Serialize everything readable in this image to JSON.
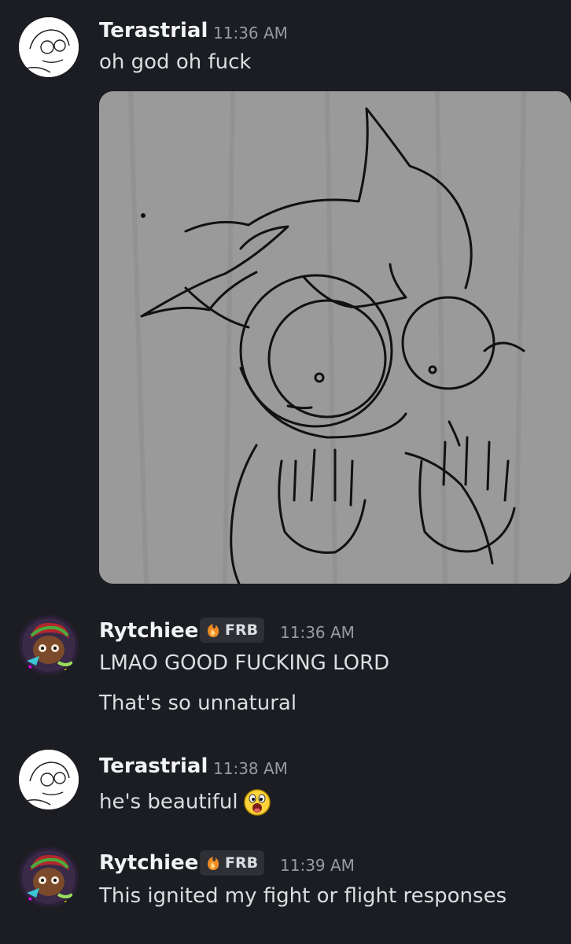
{
  "messages": [
    {
      "author": "Terastrial",
      "time": "11:36 AM",
      "lines": [
        "oh god oh fuck"
      ],
      "has_image": true,
      "avatar": "sketch-avatar"
    },
    {
      "author": "Rytchiee",
      "tag": "FRB",
      "time": "11:36 AM",
      "lines": [
        "LMAO GOOD FUCKING LORD",
        "That's so unnatural"
      ],
      "avatar": "colorful-avatar"
    },
    {
      "author": "Terastrial",
      "time": "11:38 AM",
      "lines": [
        "he's beautiful"
      ],
      "emoji": "excited-face-emoji",
      "avatar": "sketch-avatar"
    },
    {
      "author": "Rytchiee",
      "tag": "FRB",
      "time": "11:39 AM",
      "lines": [
        "This ignited my fight or flight responses"
      ],
      "avatar": "colorful-avatar"
    }
  ],
  "colors": {
    "background": "#1c1d22",
    "name": "#f2f3f5",
    "text": "#dbdee1",
    "timestamp": "#949ba4",
    "tag_bg": "#2e3036"
  }
}
